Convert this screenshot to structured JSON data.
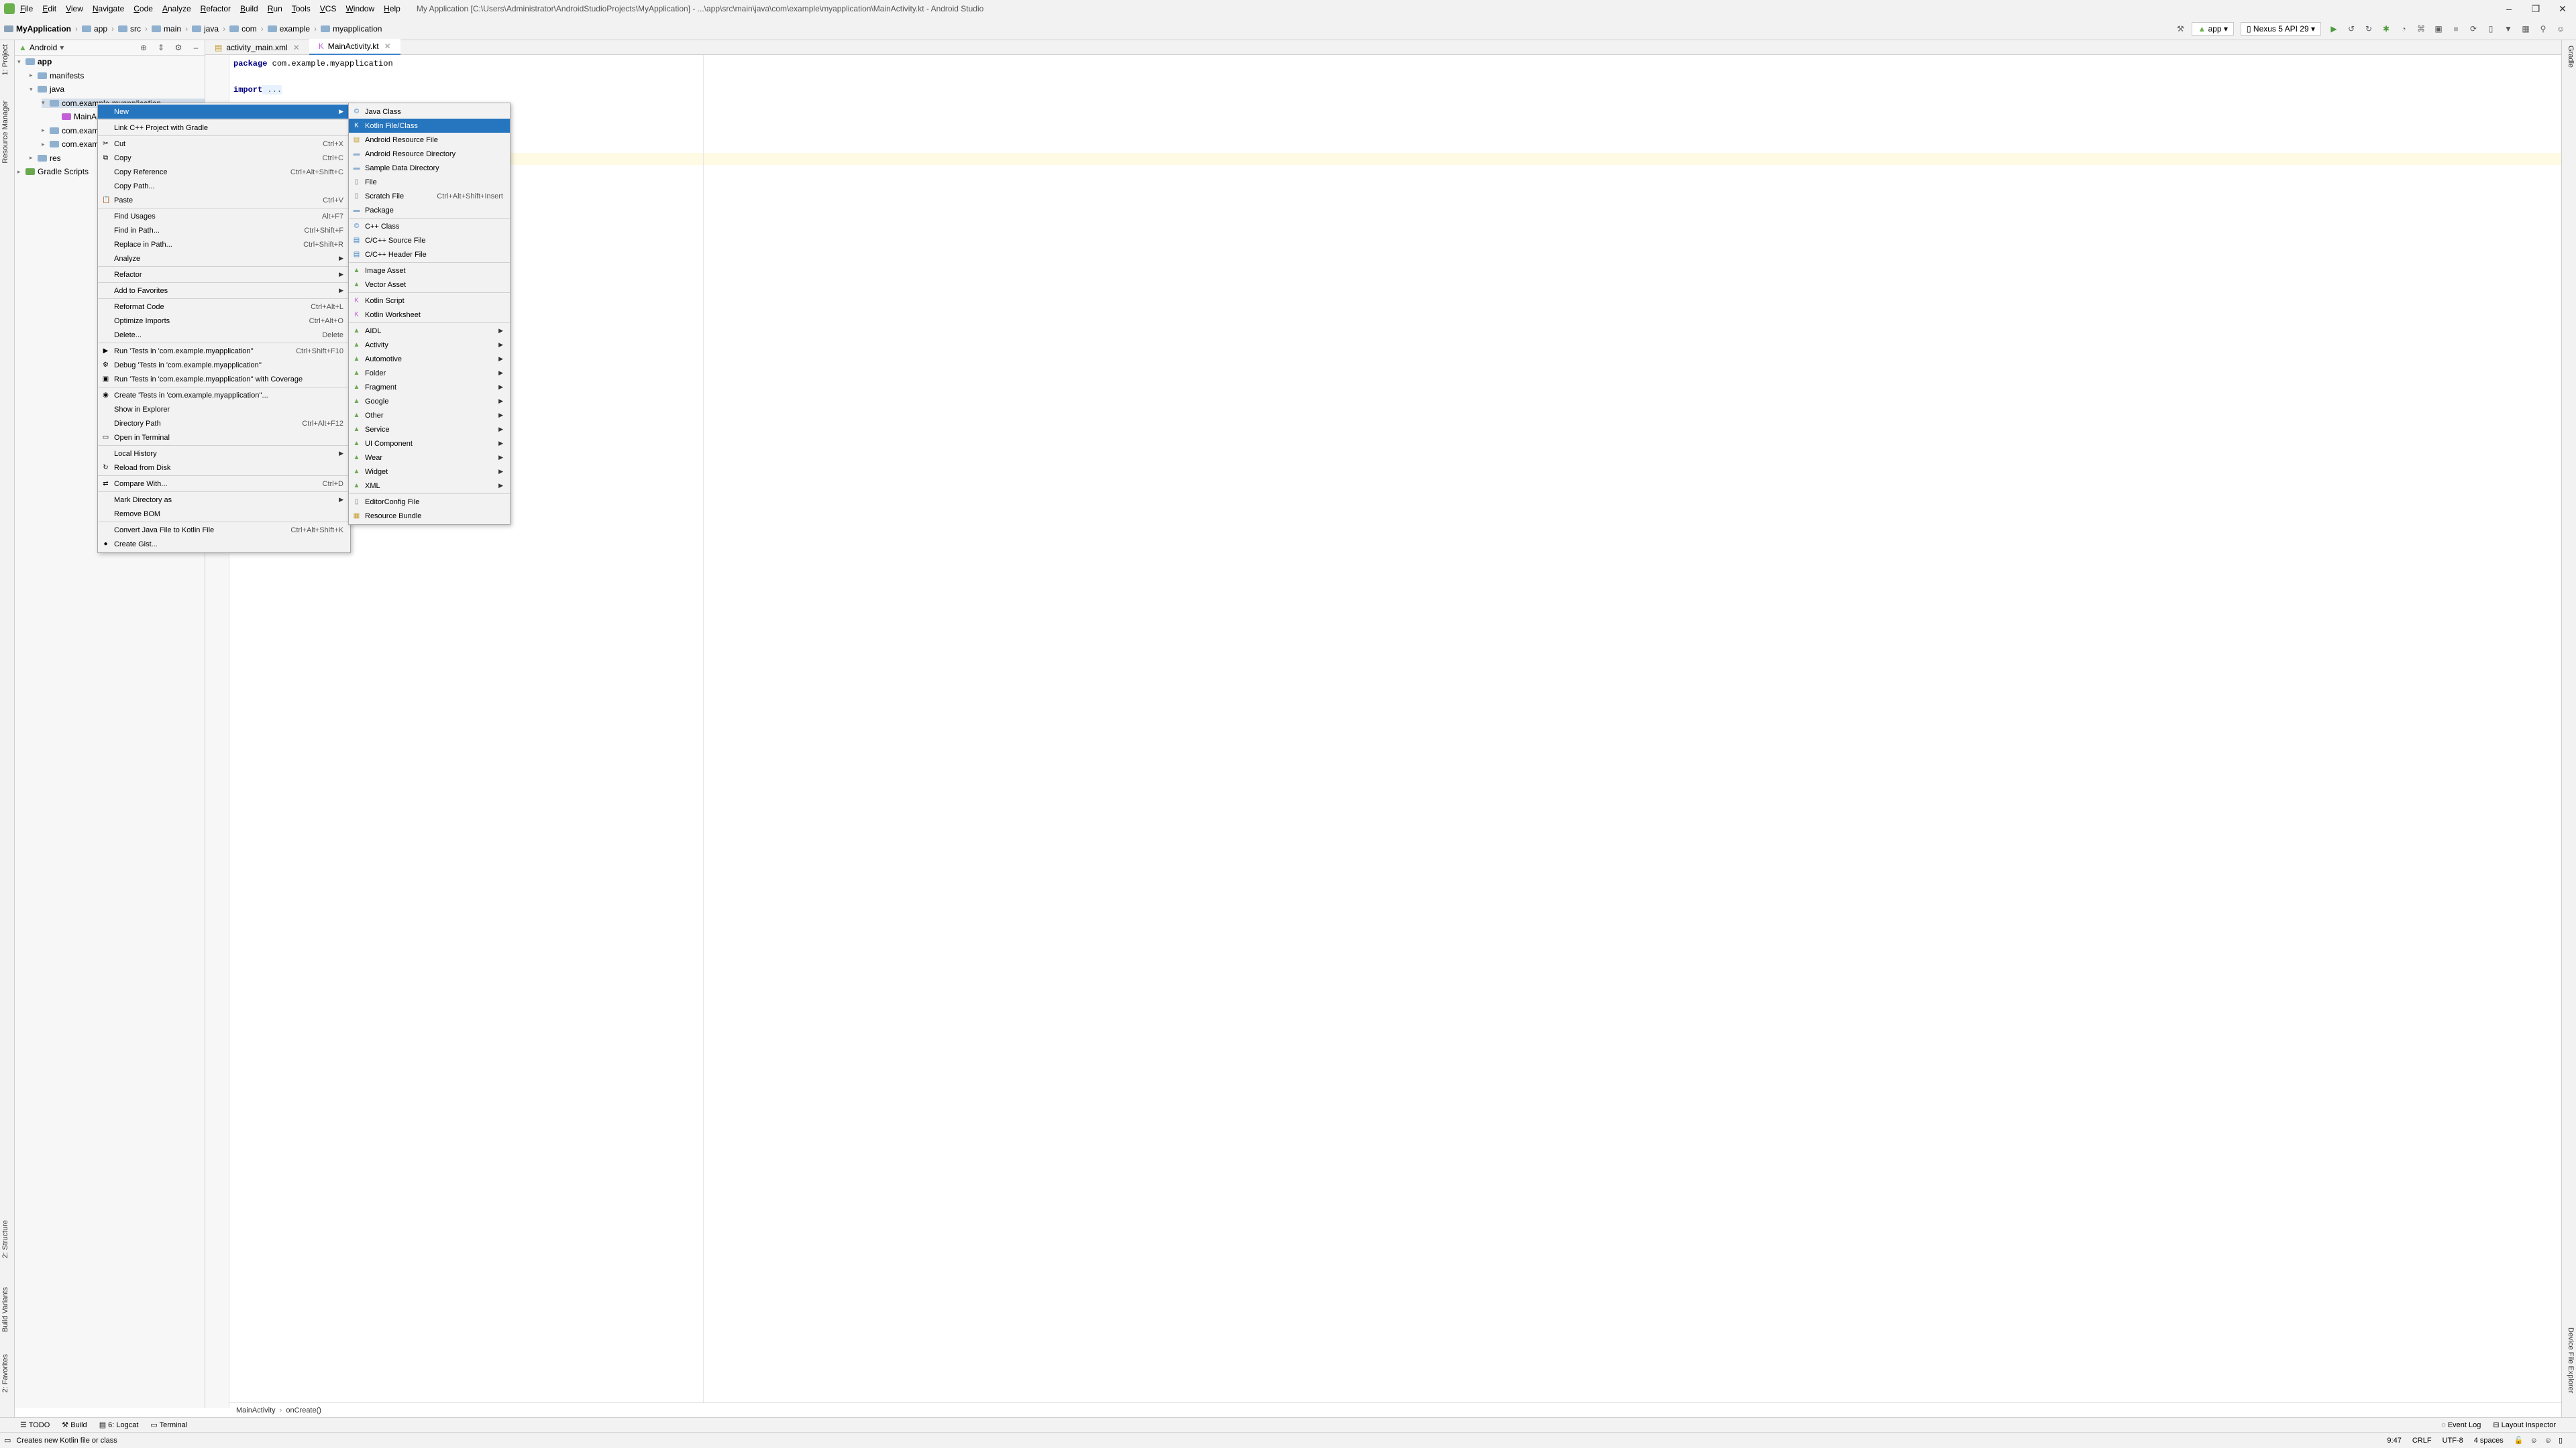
{
  "menubar": {
    "items": [
      "File",
      "Edit",
      "View",
      "Navigate",
      "Code",
      "Analyze",
      "Refactor",
      "Build",
      "Run",
      "Tools",
      "VCS",
      "Window",
      "Help"
    ],
    "title": "My Application [C:\\Users\\Administrator\\AndroidStudioProjects\\MyApplication] - ...\\app\\src\\main\\java\\com\\example\\myapplication\\MainActivity.kt - Android Studio"
  },
  "navbar": {
    "breadcrumbs": [
      "MyApplication",
      "app",
      "src",
      "main",
      "java",
      "com",
      "example",
      "myapplication"
    ],
    "run_config": "app",
    "device": "Nexus 5 API 29"
  },
  "left_stripe": {
    "project": "1: Project",
    "resource_manager": "Resource Manager",
    "structure": "2: Structure",
    "build_variants": "Build Variants",
    "favorites": "2: Favorites"
  },
  "right_stripe": {
    "gradle": "Gradle",
    "device_file_explorer": "Device File Explorer"
  },
  "project_panel": {
    "view": "Android",
    "tree": [
      {
        "label": "app",
        "indent": 0
      },
      {
        "label": "manifests",
        "indent": 1
      },
      {
        "label": "java",
        "indent": 1
      },
      {
        "label": "com.example.myapplication",
        "indent": 2
      },
      {
        "label": "MainActivity",
        "indent": 3
      },
      {
        "label": "com.example.myapplication (androidTest)",
        "indent": 2
      },
      {
        "label": "com.example.myapplication (test)",
        "indent": 2
      },
      {
        "label": "res",
        "indent": 1
      },
      {
        "label": "Gradle Scripts",
        "indent": 0
      }
    ]
  },
  "editor": {
    "tabs": [
      "activity_main.xml",
      "MainActivity.kt"
    ],
    "code": {
      "line1_kw": "package",
      "line1": " com.example.myapplication",
      "line3_kw": "import",
      "line3": " ..."
    },
    "breadcrumb": [
      "MainActivity",
      "onCreate()"
    ]
  },
  "context_menu": [
    {
      "label": "New",
      "submenu": true,
      "selected": true
    },
    {
      "sep": true
    },
    {
      "label": "Link C++ Project with Gradle"
    },
    {
      "sep": true
    },
    {
      "label": "Cut",
      "shortcut": "Ctrl+X",
      "icon": "✂"
    },
    {
      "label": "Copy",
      "shortcut": "Ctrl+C",
      "icon": "⧉"
    },
    {
      "label": "Copy Reference",
      "shortcut": "Ctrl+Alt+Shift+C"
    },
    {
      "label": "Copy Path...",
      "shortcut": ""
    },
    {
      "label": "Paste",
      "shortcut": "Ctrl+V",
      "icon": "📋"
    },
    {
      "sep": true
    },
    {
      "label": "Find Usages",
      "shortcut": "Alt+F7"
    },
    {
      "label": "Find in Path...",
      "shortcut": "Ctrl+Shift+F"
    },
    {
      "label": "Replace in Path...",
      "shortcut": "Ctrl+Shift+R"
    },
    {
      "label": "Analyze",
      "submenu": true
    },
    {
      "sep": true
    },
    {
      "label": "Refactor",
      "submenu": true
    },
    {
      "sep": true
    },
    {
      "label": "Add to Favorites",
      "submenu": true
    },
    {
      "sep": true
    },
    {
      "label": "Reformat Code",
      "shortcut": "Ctrl+Alt+L"
    },
    {
      "label": "Optimize Imports",
      "shortcut": "Ctrl+Alt+O"
    },
    {
      "label": "Delete...",
      "shortcut": "Delete"
    },
    {
      "sep": true
    },
    {
      "label": "Run 'Tests in 'com.example.myapplication''",
      "shortcut": "Ctrl+Shift+F10",
      "icon": "▶"
    },
    {
      "label": "Debug 'Tests in 'com.example.myapplication''",
      "icon": "⚙"
    },
    {
      "label": "Run 'Tests in 'com.example.myapplication'' with Coverage",
      "icon": "▣"
    },
    {
      "sep": true
    },
    {
      "label": "Create 'Tests in 'com.example.myapplication''...",
      "icon": "◉"
    },
    {
      "label": "Show in Explorer"
    },
    {
      "label": "Directory Path",
      "shortcut": "Ctrl+Alt+F12"
    },
    {
      "label": "Open in Terminal",
      "icon": "▭"
    },
    {
      "sep": true
    },
    {
      "label": "Local History",
      "submenu": true
    },
    {
      "label": "Reload from Disk",
      "icon": "↻"
    },
    {
      "sep": true
    },
    {
      "label": "Compare With...",
      "shortcut": "Ctrl+D",
      "icon": "⇄"
    },
    {
      "sep": true
    },
    {
      "label": "Mark Directory as",
      "submenu": true
    },
    {
      "label": "Remove BOM"
    },
    {
      "sep": true
    },
    {
      "label": "Convert Java File to Kotlin File",
      "shortcut": "Ctrl+Alt+Shift+K"
    },
    {
      "label": "Create Gist...",
      "icon": "●"
    }
  ],
  "new_submenu": [
    {
      "label": "Java Class",
      "icon": "©",
      "color": "#3d82c4"
    },
    {
      "label": "Kotlin File/Class",
      "icon": "K",
      "color": "#c25fd8",
      "selected": true
    },
    {
      "label": "Android Resource File",
      "icon": "▤",
      "color": "#c59a2b"
    },
    {
      "label": "Android Resource Directory",
      "icon": "▬",
      "color": "#8fb0cf"
    },
    {
      "label": "Sample Data Directory",
      "icon": "▬",
      "color": "#8fb0cf"
    },
    {
      "label": "File",
      "icon": "▯",
      "color": "#777"
    },
    {
      "label": "Scratch File",
      "shortcut": "Ctrl+Alt+Shift+Insert",
      "icon": "▯",
      "color": "#777"
    },
    {
      "label": "Package",
      "icon": "▬",
      "color": "#8fb0cf"
    },
    {
      "sep": true
    },
    {
      "label": "C++ Class",
      "icon": "©",
      "color": "#3d82c4"
    },
    {
      "label": "C/C++ Source File",
      "icon": "▤",
      "color": "#3d82c4"
    },
    {
      "label": "C/C++ Header File",
      "icon": "▤",
      "color": "#3d82c4"
    },
    {
      "sep": true
    },
    {
      "label": "Image Asset",
      "icon": "▲",
      "color": "#6aa84f"
    },
    {
      "label": "Vector Asset",
      "icon": "▲",
      "color": "#6aa84f"
    },
    {
      "sep": true
    },
    {
      "label": "Kotlin Script",
      "icon": "K",
      "color": "#c25fd8"
    },
    {
      "label": "Kotlin Worksheet",
      "icon": "K",
      "color": "#c25fd8"
    },
    {
      "sep": true
    },
    {
      "label": "AIDL",
      "submenu": true,
      "icon": "▲",
      "color": "#6aa84f"
    },
    {
      "label": "Activity",
      "submenu": true,
      "icon": "▲",
      "color": "#6aa84f"
    },
    {
      "label": "Automotive",
      "submenu": true,
      "icon": "▲",
      "color": "#6aa84f"
    },
    {
      "label": "Folder",
      "submenu": true,
      "icon": "▲",
      "color": "#6aa84f"
    },
    {
      "label": "Fragment",
      "submenu": true,
      "icon": "▲",
      "color": "#6aa84f"
    },
    {
      "label": "Google",
      "submenu": true,
      "icon": "▲",
      "color": "#6aa84f"
    },
    {
      "label": "Other",
      "submenu": true,
      "icon": "▲",
      "color": "#6aa84f"
    },
    {
      "label": "Service",
      "submenu": true,
      "icon": "▲",
      "color": "#6aa84f"
    },
    {
      "label": "UI Component",
      "submenu": true,
      "icon": "▲",
      "color": "#6aa84f"
    },
    {
      "label": "Wear",
      "submenu": true,
      "icon": "▲",
      "color": "#6aa84f"
    },
    {
      "label": "Widget",
      "submenu": true,
      "icon": "▲",
      "color": "#6aa84f"
    },
    {
      "label": "XML",
      "submenu": true,
      "icon": "▲",
      "color": "#6aa84f"
    },
    {
      "sep": true
    },
    {
      "label": "EditorConfig File",
      "icon": "▯",
      "color": "#777"
    },
    {
      "label": "Resource Bundle",
      "icon": "▦",
      "color": "#c59a2b"
    }
  ],
  "toolwindows": {
    "todo": "TODO",
    "build": "Build",
    "logcat": "6: Logcat",
    "terminal": "Terminal",
    "event_log": "Event Log",
    "layout_inspector": "Layout Inspector"
  },
  "status": {
    "message": "Creates new Kotlin file or class",
    "position": "9:47",
    "line_sep": "CRLF",
    "encoding": "UTF-8",
    "indent": "4 spaces"
  }
}
